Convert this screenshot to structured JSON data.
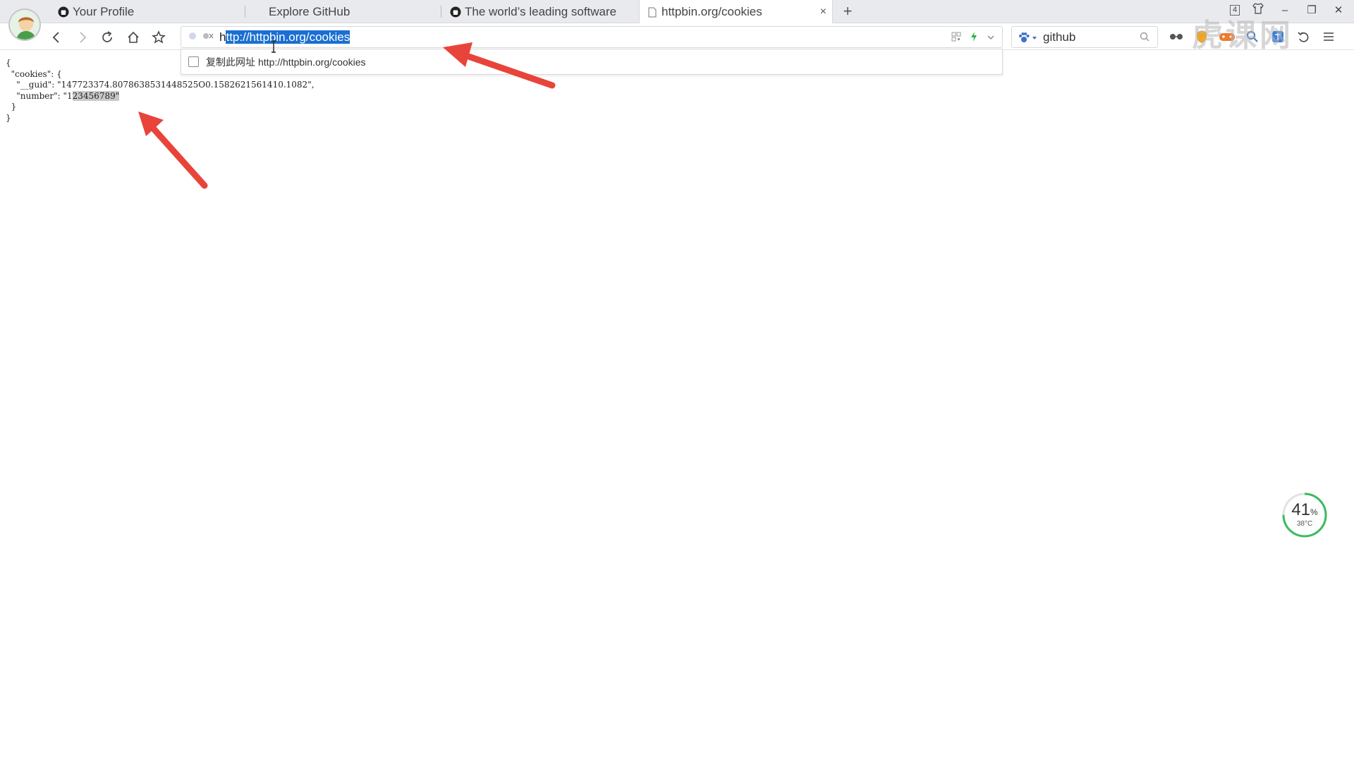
{
  "tabs": [
    {
      "label": "Your Profile",
      "icon": "github-icon",
      "active": false
    },
    {
      "label": "Explore GitHub",
      "icon": "none",
      "active": false
    },
    {
      "label": "The world’s leading software c",
      "icon": "github-icon",
      "active": false
    },
    {
      "label": "httpbin.org/cookies",
      "icon": "page-icon",
      "active": true,
      "close": "×"
    }
  ],
  "new_tab_label": "+",
  "window_controls": {
    "tab_count": "4",
    "minimize": "–",
    "restore": "❐",
    "close": "✕"
  },
  "address_bar": {
    "url_prefix": "h",
    "url_selected": "ttp://httpbin.org/cookies"
  },
  "address_dropdown": {
    "label": "复制此网址",
    "url": "http://httpbin.org/cookies"
  },
  "search": {
    "engine": "baidu-paw-icon",
    "text": "github"
  },
  "page_json": {
    "line1": "{",
    "line2_key": "\"cookies\": {",
    "guid_line": "\"__guid\": \"147723374.8078638531448525O0.1582621561410.1082\",",
    "number_prefix": "\"number\": \"1",
    "number_highlight": "23456789\"",
    "line5": "}",
    "line6": "}"
  },
  "widget": {
    "percent": "41",
    "percent_unit": "%",
    "temperature": "38°C"
  },
  "watermark": "虎课网",
  "colors": {
    "arrow": "#e8443a",
    "selection": "#1a6fd1",
    "widget_ring": "#3cba5f"
  }
}
